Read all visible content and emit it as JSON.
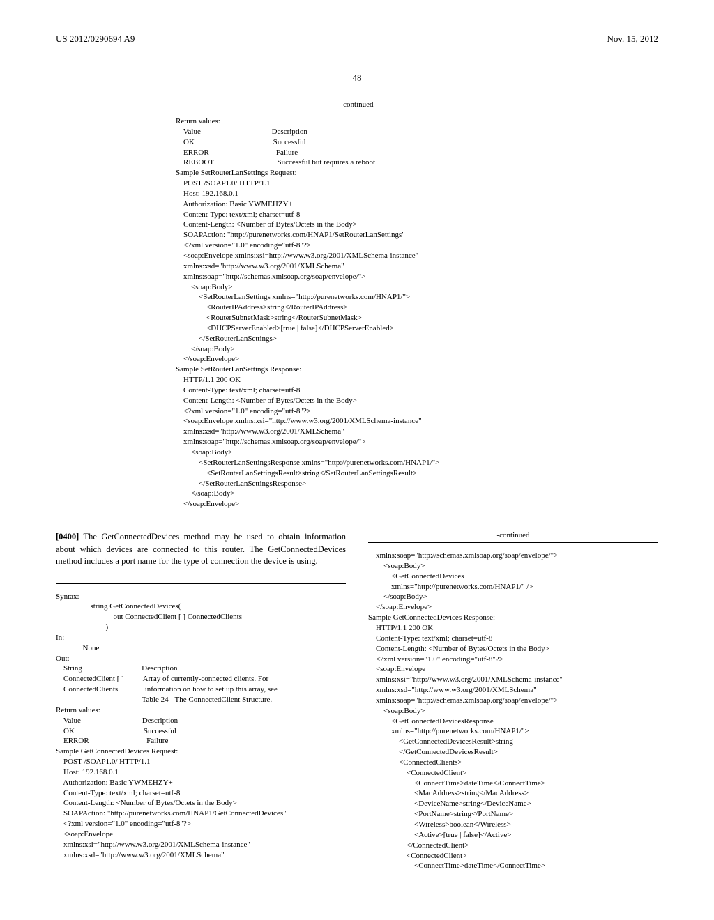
{
  "header": {
    "left": "US 2012/0290694 A9",
    "right": "Nov. 15, 2012"
  },
  "page_number": "48",
  "continued": "-continued",
  "block1_text": "Return values:\n    Value                                     Description\n    OK                                         Successful\n    ERROR                                   Failure\n    REBOOT                                 Successful but requires a reboot\nSample SetRouterLanSettings Request:\n    POST /SOAP1.0/ HTTP/1.1\n    Host: 192.168.0.1\n    Authorization: Basic YWMEHZY+\n    Content-Type: text/xml; charset=utf-8\n    Content-Length: <Number of Bytes/Octets in the Body>\n    SOAPAction: \"http://purenetworks.com/HNAP1/SetRouterLanSettings\"\n    <?xml version=\"1.0\" encoding=\"utf-8\"?>\n    <soap:Envelope xmlns:xsi=http://www.w3.org/2001/XMLSchema-instance\"\n    xmlns:xsd=\"http://www.w3.org/2001/XMLSchema\"\n    xmlns:soap=\"http://schemas.xmlsoap.org/soap/envelope/\">\n        <soap:Body>\n            <SetRouterLanSettings xmlns=\"http://purenetworks.com/HNAP1/\">\n                <RouterIPAddress>string</RouterIPAddress>\n                <RouterSubnetMask>string</RouterSubnetMask>\n                <DHCPServerEnabled>[true | false]</DHCPServerEnabled>\n            </SetRouterLanSettings>\n        </soap:Body>\n    </soap:Envelope>\nSample SetRouterLanSettings Response:\n    HTTP/1.1 200 OK\n    Content-Type: text/xml; charset=utf-8\n    Content-Length: <Number of Bytes/Octets in the Body>\n    <?xml version=\"1.0\" encoding=\"utf-8\"?>\n    <soap:Envelope xmlns:xsi=\"http://www.w3.org/2001/XMLSchema-instance\"\n    xmlns:xsd=\"http://www.w3.org/2001/XMLSchema\"\n    xmlns:soap=\"http://schemas.xmlsoap.org/soap/envelope/\">\n        <soap:Body>\n            <SetRouterLanSettingsResponse xmlns=\"http://purenetworks.com/HNAP1/\">\n                <SetRouterLanSettingsResult>string</SetRouterLanSettingsResult>\n            </SetRouterLanSettingsResponse>\n        </soap:Body>\n    </soap:Envelope>",
  "para": {
    "label": "[0400]",
    "text": "  The GetConnectedDevices method may be used to obtain information about which devices are connected to this router. The GetConnectedDevices method includes a port name for the type of connection the device is using."
  },
  "block2_text": "Syntax:\n                  string GetConnectedDevices(\n                              out ConnectedClient [ ] ConnectedClients\n                          )\nIn:\n              None\nOut:\n    String                               Description\n    ConnectedClient [ ]          Array of currently-connected clients. For\n    ConnectedClients              information on how to set up this array, see\n                                             Table 24 - The ConnectedClient Structure.\nReturn values:\n    Value                                Description\n    OK                                    Successful\n    ERROR                              Failure\nSample GetConnectedDevices Request:\n    POST /SOAP1.0/ HTTP/1.1\n    Host: 192.168.0.1\n    Authorization: Basic YWMEHZY+\n    Content-Type: text/xml; charset=utf-8\n    Content-Length: <Number of Bytes/Octets in the Body>\n    SOAPAction: \"http://purenetworks.com/HNAP1/GetConnectedDevices\"\n    <?xml version=\"1.0\" encoding=\"utf-8\"?>\n    <soap:Envelope\n    xmlns:xsi=\"http://www.w3.org/2001/XMLSchema-instance\"\n    xmlns:xsd=\"http://www.w3.org/2001/XMLSchema\"",
  "block3_text": "    xmlns:soap=\"http://schemas.xmlsoap.org/soap/envelope/\">\n        <soap:Body>\n            <GetConnectedDevices\n            xmlns=\"http://purenetworks.com/HNAP1/\" />\n        </soap:Body>\n    </soap:Envelope>\nSample GetConnectedDevices Response:\n    HTTP/1.1 200 OK\n    Content-Type: text/xml; charset=utf-8\n    Content-Length: <Number of Bytes/Octets in the Body>\n    <?xml version=\"1.0\" encoding=\"utf-8\"?>\n    <soap:Envelope\n    xmlns:xsi=\"http://www.w3.org/2001/XMLSchema-instance\"\n    xmlns:xsd=\"http://www.w3.org/2001/XMLSchema\"\n    xmlns:soap=\"http://schemas.xmlsoap.org/soap/envelope/\">\n        <soap:Body>\n            <GetConnectedDevicesResponse\n            xmlns=\"http://purenetworks.com/HNAP1/\">\n                <GetConnectedDevicesResult>string\n                </GetConnectedDevicesResult>\n                <ConnectedClients>\n                    <ConnectedClient>\n                        <ConnectTime>dateTime</ConnectTime>\n                        <MacAddress>string</MacAddress>\n                        <DeviceName>string</DeviceName>\n                        <PortName>string</PortName>\n                        <Wireless>boolean</Wireless>\n                        <Active>[true | false]</Active>\n                    </ConnectedClient>\n                    <ConnectedClient>\n                        <ConnectTime>dateTime</ConnectTime>"
}
